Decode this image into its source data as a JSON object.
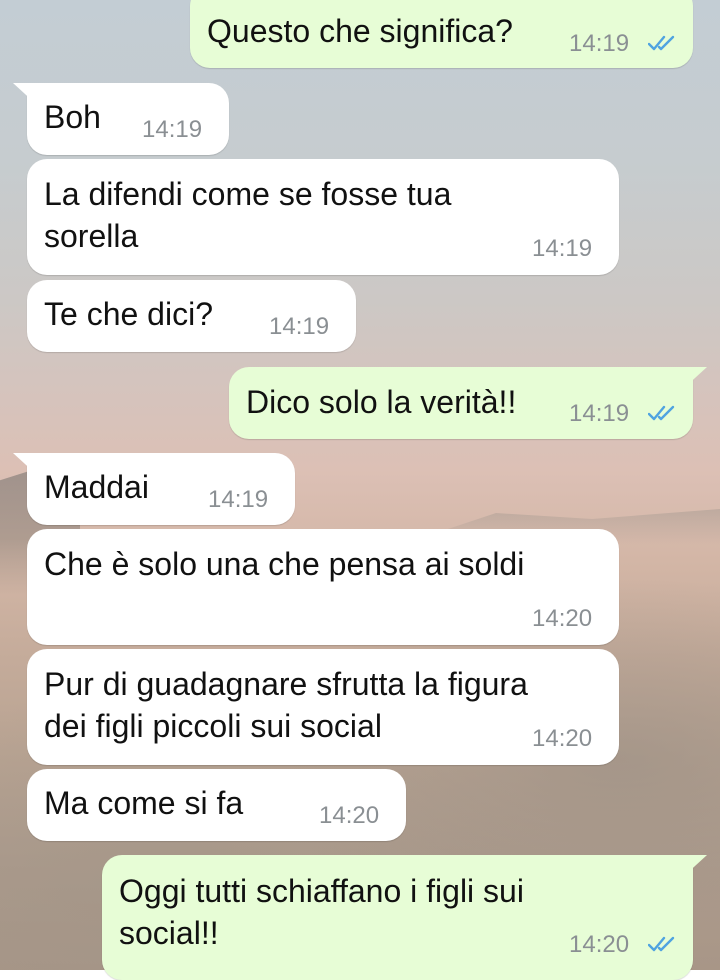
{
  "colors": {
    "incoming_bubble": "#ffffff",
    "outgoing_bubble": "#e7fdd6",
    "timestamp": "#8a8f93",
    "read_ticks": "#4fa3e0"
  },
  "messages": [
    {
      "direction": "outgoing",
      "text": "Questo che significa?",
      "time": "14:19",
      "status": "read"
    },
    {
      "direction": "incoming",
      "text": "Boh",
      "time": "14:19"
    },
    {
      "direction": "incoming",
      "text": "La difendi come se fosse tua\nsorella",
      "time": "14:19"
    },
    {
      "direction": "incoming",
      "text": "Te che dici?",
      "time": "14:19"
    },
    {
      "direction": "outgoing",
      "text": "Dico solo la verità!!",
      "time": "14:19",
      "status": "read"
    },
    {
      "direction": "incoming",
      "text": "Maddai",
      "time": "14:19"
    },
    {
      "direction": "incoming",
      "text": "Che è solo una che pensa ai soldi",
      "time": "14:20"
    },
    {
      "direction": "incoming",
      "text": "Pur di guadagnare sfrutta la figura\ndei figli piccoli sui social",
      "time": "14:20"
    },
    {
      "direction": "incoming",
      "text": "Ma come si fa",
      "time": "14:20"
    },
    {
      "direction": "outgoing",
      "text": "Oggi tutti schiaffano i figli sui\nsocial!!",
      "time": "14:20",
      "status": "read"
    }
  ]
}
